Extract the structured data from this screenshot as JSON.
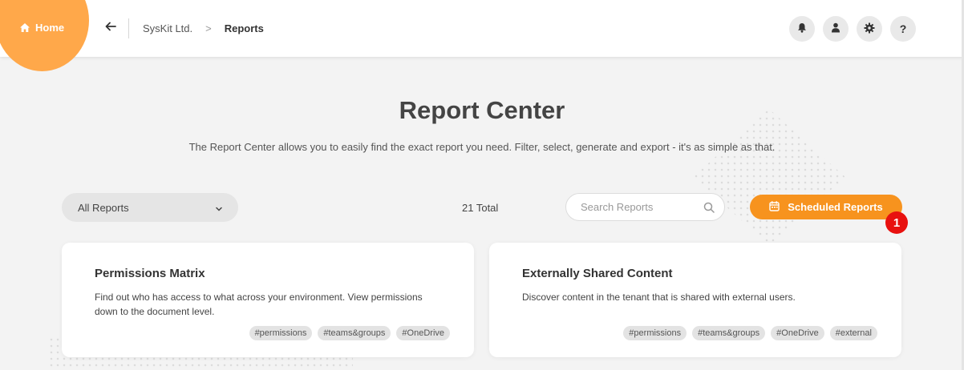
{
  "header": {
    "home_label": "Home",
    "breadcrumb": {
      "parent": "SysKit Ltd.",
      "separator": ">",
      "current": "Reports"
    },
    "icons": [
      "bell-icon",
      "user-icon",
      "gear-icon",
      "help-icon"
    ],
    "help_glyph": "?"
  },
  "main": {
    "title": "Report Center",
    "subtitle": "The Report Center allows you to easily find the exact report you need. Filter, select, generate and export - it's as simple as that.",
    "filter": {
      "selected": "All Reports"
    },
    "total": "21 Total",
    "search": {
      "placeholder": "Search Reports",
      "value": ""
    },
    "scheduled_button": "Scheduled Reports",
    "badge": "1",
    "cards": [
      {
        "title": "Permissions Matrix",
        "description": "Find out who has access to what across your environment. View permissions down to the document level.",
        "tags": [
          "#permissions",
          "#teams&groups",
          "#OneDrive"
        ]
      },
      {
        "title": "Externally Shared Content",
        "description": "Discover content in the tenant that is shared with external users.",
        "tags": [
          "#permissions",
          "#teams&groups",
          "#OneDrive",
          "#external"
        ]
      }
    ]
  },
  "colors": {
    "accent_orange": "#f7931e",
    "home_blob": "#ffa84a",
    "badge_red": "#e8110f",
    "background": "#f3f3f3"
  }
}
